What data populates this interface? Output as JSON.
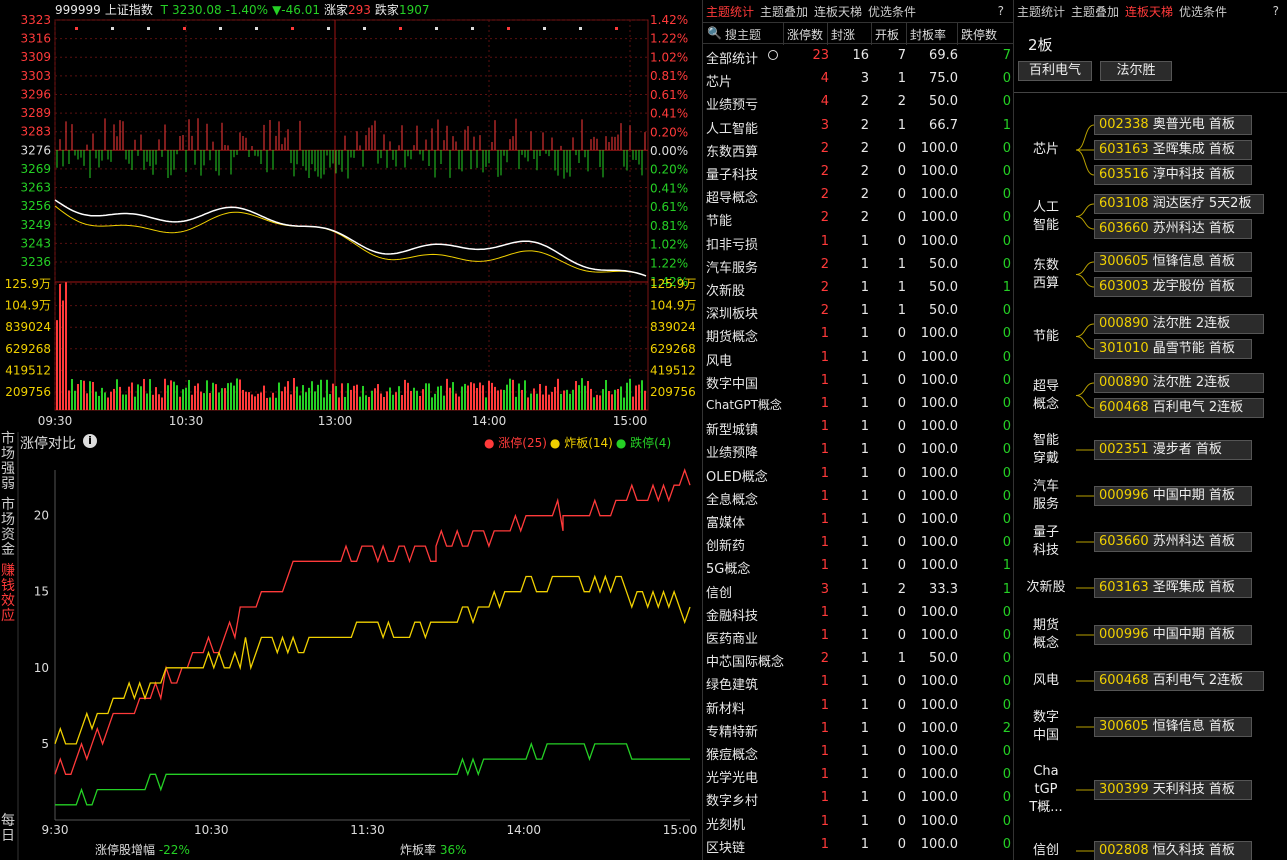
{
  "index": {
    "code": "999999",
    "name": "上证指数",
    "t": "T",
    "price": "3230.08",
    "pct": "-1.40%",
    "chg": "▼-46.01",
    "up_label": "涨家",
    "up": "293",
    "down_label": "跌家",
    "down": "1907"
  },
  "price_axis_left": [
    "3323",
    "3316",
    "3309",
    "3303",
    "3296",
    "3289",
    "3283",
    "3276",
    "3269",
    "3263",
    "3256",
    "3249",
    "3243",
    "3236"
  ],
  "price_axis_right": [
    "1.42%",
    "1.22%",
    "1.02%",
    "0.81%",
    "0.61%",
    "0.41%",
    "0.20%",
    "0.00%",
    "0.20%",
    "0.41%",
    "0.61%",
    "0.81%",
    "1.02%",
    "1.22%",
    "1.42%"
  ],
  "vol_axis": [
    "125.9万",
    "104.9万",
    "839024",
    "629268",
    "419512",
    "209756"
  ],
  "time_axis": [
    "09:30",
    "10:30",
    "13:00",
    "14:00",
    "15:00"
  ],
  "limit": {
    "title": "涨停对比",
    "legend": [
      {
        "label": "涨停(25)",
        "color": "#ff3a3a"
      },
      {
        "label": "炸板(14)",
        "color": "#f0d000"
      },
      {
        "label": "跌停(4)",
        "color": "#25d025"
      }
    ],
    "y_ticks": [
      "20",
      "15",
      "10",
      "5"
    ],
    "x_ticks": [
      "9:30",
      "10:30",
      "11:30",
      "14:00",
      "15:00"
    ],
    "footer_left_label": "涨停股增幅",
    "footer_left_value": "-22%",
    "footer_right_label": "炸板率",
    "footer_right_value": "36%"
  },
  "chart_data": {
    "type": "line",
    "x": [
      "9:30",
      "10:30",
      "11:30",
      "14:00",
      "15:00"
    ],
    "ylim": [
      0,
      23
    ],
    "series": [
      {
        "name": "涨停(25)",
        "color": "#ff3a3a",
        "values": [
          3,
          10,
          17,
          18,
          20,
          22
        ]
      },
      {
        "name": "炸板(14)",
        "color": "#f0d000",
        "values": [
          5,
          10,
          12,
          13,
          16,
          14
        ]
      },
      {
        "name": "跌停(4)",
        "color": "#25d025",
        "values": [
          1,
          3,
          3,
          3,
          5,
          4
        ]
      }
    ]
  },
  "leftnav": [
    {
      "label": "市场强弱",
      "active": false
    },
    {
      "label": "市场资金",
      "active": false
    },
    {
      "label": "赚钱效应",
      "active": true
    },
    {
      "label": "每日",
      "active": false
    }
  ],
  "table": {
    "tabs": [
      "主题统计",
      "主题叠加",
      "连板天梯",
      "优选条件"
    ],
    "active_tab": 0,
    "help": "?",
    "search_placeholder": "搜主题",
    "headers": [
      "涨停数",
      "封涨",
      "开板",
      "封板率",
      "跌停数"
    ],
    "rows": [
      [
        "全部统计",
        "23",
        "16",
        "7",
        "69.6",
        "7"
      ],
      [
        "芯片",
        "4",
        "3",
        "1",
        "75.0",
        "0"
      ],
      [
        "业绩预亏",
        "4",
        "2",
        "2",
        "50.0",
        "0"
      ],
      [
        "人工智能",
        "3",
        "2",
        "1",
        "66.7",
        "1"
      ],
      [
        "东数西算",
        "2",
        "2",
        "0",
        "100.0",
        "0"
      ],
      [
        "量子科技",
        "2",
        "2",
        "0",
        "100.0",
        "0"
      ],
      [
        "超导概念",
        "2",
        "2",
        "0",
        "100.0",
        "0"
      ],
      [
        "节能",
        "2",
        "2",
        "0",
        "100.0",
        "0"
      ],
      [
        "扣非亏损",
        "1",
        "1",
        "0",
        "100.0",
        "0"
      ],
      [
        "汽车服务",
        "2",
        "1",
        "1",
        "50.0",
        "0"
      ],
      [
        "次新股",
        "2",
        "1",
        "1",
        "50.0",
        "1"
      ],
      [
        "深圳板块",
        "2",
        "1",
        "1",
        "50.0",
        "0"
      ],
      [
        "期货概念",
        "1",
        "1",
        "0",
        "100.0",
        "0"
      ],
      [
        "风电",
        "1",
        "1",
        "0",
        "100.0",
        "0"
      ],
      [
        "数字中国",
        "1",
        "1",
        "0",
        "100.0",
        "0"
      ],
      [
        "ChatGPT概念",
        "1",
        "1",
        "0",
        "100.0",
        "0"
      ],
      [
        "新型城镇",
        "1",
        "1",
        "0",
        "100.0",
        "0"
      ],
      [
        "业绩预降",
        "1",
        "1",
        "0",
        "100.0",
        "0"
      ],
      [
        "OLED概念",
        "1",
        "1",
        "0",
        "100.0",
        "0"
      ],
      [
        "全息概念",
        "1",
        "1",
        "0",
        "100.0",
        "0"
      ],
      [
        "富媒体",
        "1",
        "1",
        "0",
        "100.0",
        "0"
      ],
      [
        "创新药",
        "1",
        "1",
        "0",
        "100.0",
        "0"
      ],
      [
        "5G概念",
        "1",
        "1",
        "0",
        "100.0",
        "1"
      ],
      [
        "信创",
        "3",
        "1",
        "2",
        "33.3",
        "1"
      ],
      [
        "金融科技",
        "1",
        "1",
        "0",
        "100.0",
        "0"
      ],
      [
        "医药商业",
        "1",
        "1",
        "0",
        "100.0",
        "0"
      ],
      [
        "中芯国际概念",
        "2",
        "1",
        "1",
        "50.0",
        "0"
      ],
      [
        "绿色建筑",
        "1",
        "1",
        "0",
        "100.0",
        "0"
      ],
      [
        "新材料",
        "1",
        "1",
        "0",
        "100.0",
        "0"
      ],
      [
        "专精特新",
        "1",
        "1",
        "0",
        "100.0",
        "2"
      ],
      [
        "猴痘概念",
        "1",
        "1",
        "0",
        "100.0",
        "0"
      ],
      [
        "光学光电",
        "1",
        "1",
        "0",
        "100.0",
        "0"
      ],
      [
        "数字乡村",
        "1",
        "1",
        "0",
        "100.0",
        "0"
      ],
      [
        "光刻机",
        "1",
        "1",
        "0",
        "100.0",
        "0"
      ],
      [
        "区块链",
        "1",
        "1",
        "0",
        "100.0",
        "0"
      ]
    ]
  },
  "ladder": {
    "tabs": [
      "主题统计",
      "主题叠加",
      "连板天梯",
      "优选条件"
    ],
    "active_tab": 2,
    "help": "?",
    "level": "2板",
    "level_stocks": [
      "百利电气",
      "法尔胜"
    ],
    "groups": [
      {
        "theme": "芯片",
        "stocks": [
          [
            "002338",
            "奥普光电",
            "首板"
          ],
          [
            "603163",
            "圣晖集成",
            "首板"
          ],
          [
            "603516",
            "淳中科技",
            "首板"
          ]
        ]
      },
      {
        "theme": "人工智能",
        "stocks": [
          [
            "603108",
            "润达医疗",
            "5天2板"
          ],
          [
            "603660",
            "苏州科达",
            "首板"
          ]
        ]
      },
      {
        "theme": "东数西算",
        "stocks": [
          [
            "300605",
            "恒锋信息",
            "首板"
          ],
          [
            "603003",
            "龙宇股份",
            "首板"
          ]
        ]
      },
      {
        "theme": "节能",
        "stocks": [
          [
            "000890",
            "法尔胜",
            "2连板"
          ],
          [
            "301010",
            "晶雪节能",
            "首板"
          ]
        ]
      },
      {
        "theme": "超导概念",
        "stocks": [
          [
            "000890",
            "法尔胜",
            "2连板"
          ],
          [
            "600468",
            "百利电气",
            "2连板"
          ]
        ]
      },
      {
        "theme": "智能穿戴",
        "stocks": [
          [
            "002351",
            "漫步者",
            "首板"
          ]
        ]
      },
      {
        "theme": "汽车服务",
        "stocks": [
          [
            "000996",
            "中国中期",
            "首板"
          ]
        ]
      },
      {
        "theme": "量子科技",
        "stocks": [
          [
            "603660",
            "苏州科达",
            "首板"
          ]
        ]
      },
      {
        "theme": "次新股",
        "stocks": [
          [
            "603163",
            "圣晖集成",
            "首板"
          ]
        ]
      },
      {
        "theme": "期货概念",
        "stocks": [
          [
            "000996",
            "中国中期",
            "首板"
          ]
        ]
      },
      {
        "theme": "风电",
        "stocks": [
          [
            "600468",
            "百利电气",
            "2连板"
          ]
        ]
      },
      {
        "theme": "数字中国",
        "stocks": [
          [
            "300605",
            "恒锋信息",
            "首板"
          ]
        ]
      },
      {
        "theme": "ChatGPT概...",
        "stocks": [
          [
            "300399",
            "天利科技",
            "首板"
          ]
        ]
      },
      {
        "theme": "信创",
        "stocks": [
          [
            "002808",
            "恒久科技",
            "首板"
          ]
        ]
      }
    ]
  }
}
